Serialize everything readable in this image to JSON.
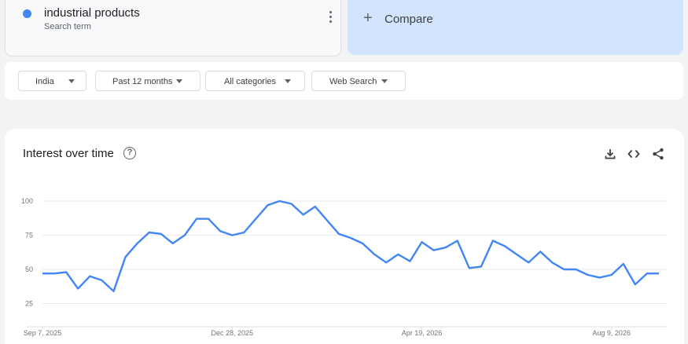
{
  "search_term": {
    "name": "industrial products",
    "subtitle": "Search term",
    "color": "#4285f4"
  },
  "compare": {
    "plus": "+",
    "label": "Compare"
  },
  "filters": [
    {
      "label": "India"
    },
    {
      "label": "Past 12 months"
    },
    {
      "label": "All categories"
    },
    {
      "label": "Web Search"
    }
  ],
  "chart_section": {
    "title": "Interest over time",
    "help_icon": "?",
    "toolbar_icons": [
      "download-icon",
      "embed-icon",
      "share-icon"
    ]
  },
  "chart_data": {
    "type": "line",
    "x_tick_labels": [
      "Sep 7, 2025",
      "Dec 28, 2025",
      "Apr 19, 2026",
      "Aug 9, 2026"
    ],
    "y_ticks": [
      25,
      50,
      75,
      100
    ],
    "ylim": [
      0,
      100
    ],
    "grid": true,
    "series": [
      {
        "color": "#4285f4",
        "x_start": "2025-09-07",
        "values": [
          47,
          47,
          48,
          36,
          45,
          42,
          34,
          59,
          69,
          77,
          76,
          69,
          75,
          87,
          87,
          78,
          75,
          77,
          87,
          97,
          100,
          98,
          90,
          96,
          86,
          76,
          73,
          69,
          61,
          55,
          61,
          56,
          70,
          64,
          66,
          71,
          51,
          52,
          71,
          67,
          61,
          55,
          63,
          55,
          50,
          50,
          46,
          44,
          46,
          54,
          39,
          47,
          47
        ]
      }
    ]
  }
}
